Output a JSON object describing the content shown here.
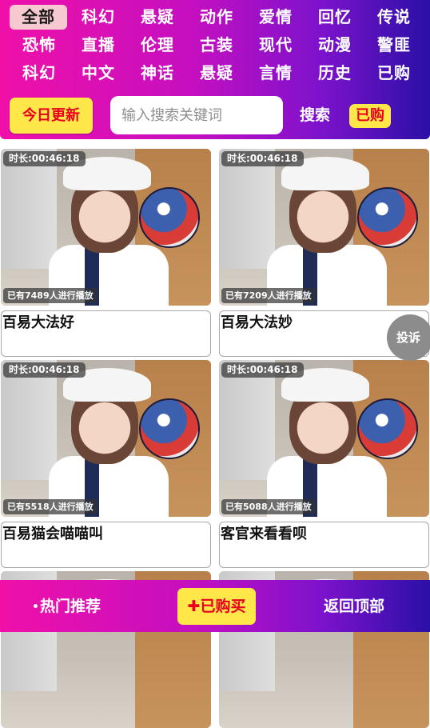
{
  "categories": [
    {
      "label": "全部",
      "active": true
    },
    {
      "label": "科幻"
    },
    {
      "label": "悬疑"
    },
    {
      "label": "动作"
    },
    {
      "label": "爱情"
    },
    {
      "label": "回忆"
    },
    {
      "label": "传说"
    },
    {
      "label": "恐怖"
    },
    {
      "label": "直播"
    },
    {
      "label": "伦理"
    },
    {
      "label": "古装"
    },
    {
      "label": "现代"
    },
    {
      "label": "动漫"
    },
    {
      "label": "警匪"
    },
    {
      "label": "科幻"
    },
    {
      "label": "中文"
    },
    {
      "label": "神话"
    },
    {
      "label": "悬疑"
    },
    {
      "label": "言情"
    },
    {
      "label": "历史"
    },
    {
      "label": "已购"
    }
  ],
  "toolbar": {
    "today_label": "今日更新",
    "search_placeholder": "输入搜索关键词",
    "search_label": "搜索",
    "bought_label": "已购"
  },
  "videos": [
    {
      "duration": "时长:00:46:18",
      "plays": "已有7489人进行播放",
      "title": "百易大法好"
    },
    {
      "duration": "时长:00:46:18",
      "plays": "已有7209人进行播放",
      "title": "百易大法妙"
    },
    {
      "duration": "时长:00:46:18",
      "plays": "已有5518人进行播放",
      "title": "百易猫会喵喵叫"
    },
    {
      "duration": "时长:00:46:18",
      "plays": "已有5088人进行播放",
      "title": "客官来看看呗"
    }
  ],
  "complain_label": "投诉",
  "bottom_bar": {
    "hot_label": "热门推荐",
    "purchased_label": "✚已购买",
    "top_label": "返回顶部"
  },
  "colors": {
    "gradient_start": "#f010a8",
    "gradient_end": "#2a10a6",
    "button_yellow": "#ffe74a",
    "button_text_red": "#e8001e",
    "active_tab_bg": "#f6c8cf"
  }
}
